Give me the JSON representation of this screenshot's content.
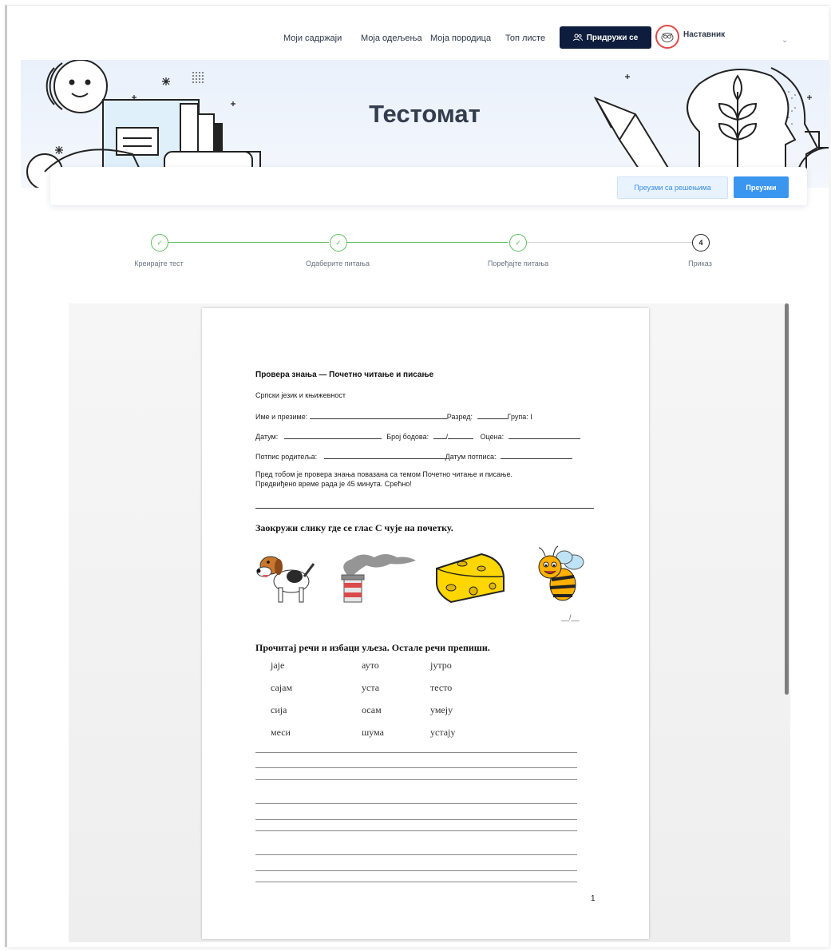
{
  "nav": {
    "links": [
      "Моји садржаји",
      "Моја одељења",
      "Моја породица",
      "Топ листе"
    ],
    "join_label": "Придружи се",
    "role_label": "Наставник"
  },
  "banner": {
    "title": "Тестомат"
  },
  "actions": {
    "download_with_solutions": "Преузми са решењима",
    "download": "Преузми"
  },
  "stepper": {
    "steps": [
      {
        "label": "Креирајте тест",
        "state": "done"
      },
      {
        "label": "Одаберите питања",
        "state": "done"
      },
      {
        "label": "Поређајте питања",
        "state": "done"
      },
      {
        "label": "Приказ",
        "state": "current",
        "number": "4"
      }
    ],
    "done_color": "#5cc05c"
  },
  "paper": {
    "title": "Провера знања — Почетно читање и писање",
    "subject": "Српски језик и књижевност",
    "name_label": "Име и презиме:",
    "grade_label": "Разред:",
    "group_label": "Група: I",
    "date_label": "Датум:",
    "points_label": "Број бодова:",
    "points_sep": "/",
    "mark_label": "Оцена:",
    "parent_sign_label": "Потпис родитеља:",
    "sign_date_label": "Датум потписа:",
    "intro_1": "Пред тобом је провера знања повазана са темом Почетно читање и писање.",
    "intro_2": "Предвиђено време рада је 45 минута. Срећно!",
    "q1": "Заокружи слику где се глас С чује на почетку.",
    "q1_score": "__/__",
    "pictures": [
      "dog",
      "chimney-smoke",
      "cheese",
      "bee"
    ],
    "q2": "Прочитај речи и избаци уљеза. Остале речи препиши.",
    "words": [
      [
        "јаје",
        "ауто",
        "јутро"
      ],
      [
        "сајам",
        "уста",
        "тесто"
      ],
      [
        "сија",
        "осам",
        "умеју"
      ],
      [
        "меси",
        "шума",
        "устају"
      ]
    ],
    "page_number": "1"
  },
  "colors": {
    "brand_dark": "#0e1d3d",
    "accent": "#3a96ee",
    "banner_bg": "#eaf1fb"
  }
}
